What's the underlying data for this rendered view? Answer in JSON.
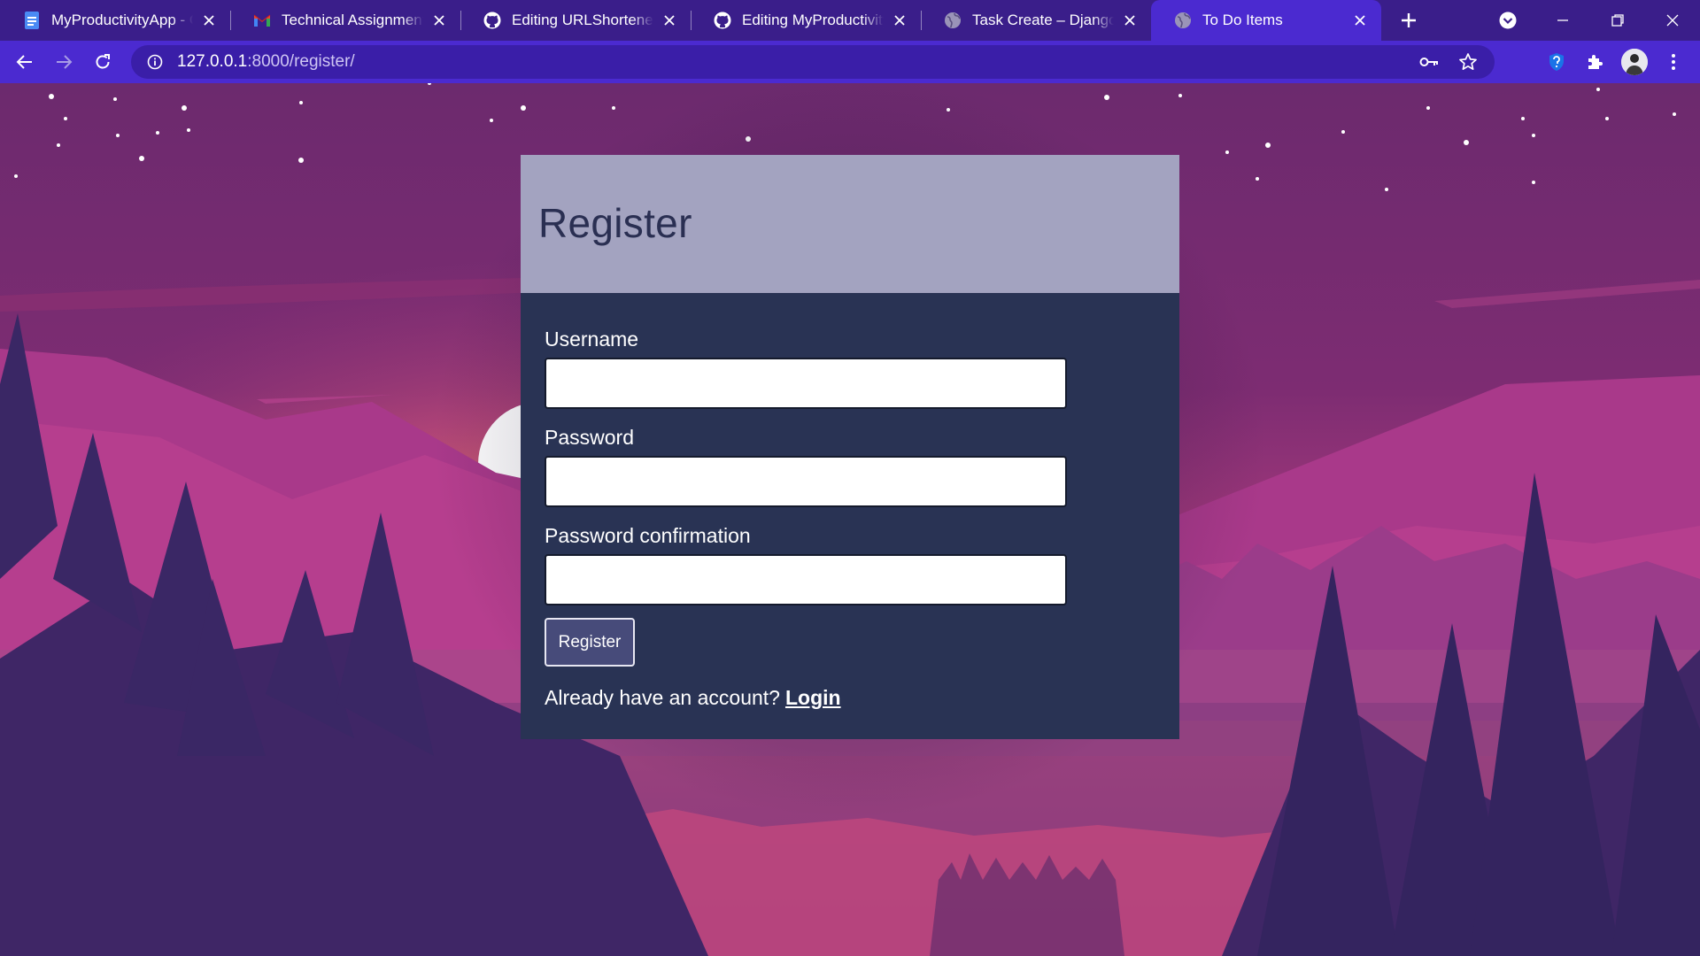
{
  "browser": {
    "tabs": [
      {
        "title": "MyProductivityApp - Go",
        "icon": "google-docs-icon",
        "active": false
      },
      {
        "title": "Technical Assignments f",
        "icon": "gmail-icon",
        "active": false
      },
      {
        "title": "Editing URLShortener/R",
        "icon": "github-icon",
        "active": false
      },
      {
        "title": "Editing MyProductivityA",
        "icon": "github-icon",
        "active": false
      },
      {
        "title": "Task Create – Django RE",
        "icon": "globe-icon",
        "active": false
      },
      {
        "title": "To Do Items",
        "icon": "globe-icon",
        "active": true
      }
    ],
    "url_host": "127.0.0.1",
    "url_rest": ":8000/register/",
    "colors": {
      "tabstrip": "#3a1e8a",
      "toolbar": "#4b2ad0",
      "omnibox": "#3a1ea8"
    }
  },
  "page": {
    "title": "Register",
    "fields": [
      {
        "label": "Username",
        "value": ""
      },
      {
        "label": "Password",
        "value": ""
      },
      {
        "label": "Password confirmation",
        "value": ""
      }
    ],
    "submit_label": "Register",
    "login_prompt": "Already have an account?",
    "login_link": "Login",
    "colors": {
      "card_header": "#a3a3c0",
      "card_body": "#293354",
      "button": "#474b7a"
    }
  }
}
